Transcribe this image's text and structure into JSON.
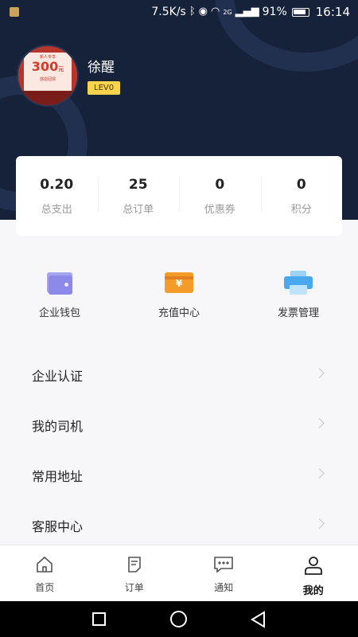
{
  "status_bar": {
    "speed": "7.5K/s",
    "network": "2G",
    "battery": "91%",
    "time": "16:14"
  },
  "profile": {
    "username": "徐醒",
    "level": "LEV0",
    "avatar": {
      "tag": "新人专享",
      "amount": "300",
      "unit": "元",
      "subtitle": "感恩回馈"
    }
  },
  "stats": [
    {
      "value": "0.20",
      "label": "总支出"
    },
    {
      "value": "25",
      "label": "总订单"
    },
    {
      "value": "0",
      "label": "优惠券"
    },
    {
      "value": "0",
      "label": "积分"
    }
  ],
  "quick_actions": [
    {
      "label": "企业钱包",
      "icon": "wallet-icon",
      "color": "#8d89e9"
    },
    {
      "label": "充值中心",
      "icon": "recharge-card-icon",
      "color": "#f39c2a"
    },
    {
      "label": "发票管理",
      "icon": "printer-icon",
      "color": "#4aa8ee"
    }
  ],
  "menu": [
    {
      "label": "企业认证"
    },
    {
      "label": "我的司机"
    },
    {
      "label": "常用地址"
    },
    {
      "label": "客服中心"
    }
  ],
  "tabs": [
    {
      "label": "首页",
      "icon": "home-icon"
    },
    {
      "label": "订单",
      "icon": "order-icon"
    },
    {
      "label": "通知",
      "icon": "message-icon"
    },
    {
      "label": "我的",
      "icon": "user-icon",
      "active": true
    }
  ],
  "colors": {
    "header_bg": "#16213a",
    "level_badge": "#f7d44b"
  }
}
